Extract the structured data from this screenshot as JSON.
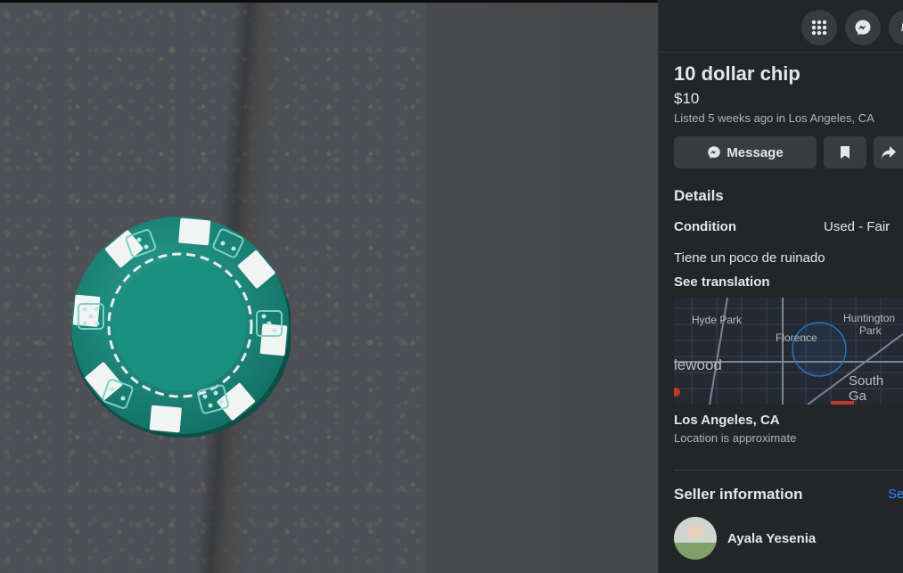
{
  "listing": {
    "title": "10 dollar chip",
    "price": "$10",
    "listed": "Listed 5 weeks ago in Los Angeles, CA"
  },
  "actions": {
    "message_label": "Message",
    "save_icon": "bookmark-icon",
    "share_icon": "share-arrow-icon"
  },
  "topbar": {
    "icons": [
      "apps-grid-icon",
      "messenger-icon",
      "notifications-bell-icon"
    ]
  },
  "details": {
    "heading": "Details",
    "condition_label": "Condition",
    "condition_value": "Used - Fair",
    "description": "Tiene un poco de ruinado",
    "see_translation": "See translation"
  },
  "map": {
    "labels": {
      "hyde_park": "Hyde Park",
      "huntington_line1": "Huntington",
      "huntington_line2": "Park",
      "florence": "Florence",
      "inglewood": "lewood",
      "south_gate": "South Ga"
    }
  },
  "location": {
    "name": "Los Angeles, CA",
    "note": "Location is approximate"
  },
  "seller": {
    "heading": "Seller information",
    "see_link": "Se",
    "name": "Ayala Yesenia"
  },
  "colors": {
    "panel_bg": "#242526",
    "button_bg": "#3a3b3c",
    "text": "#e4e6eb",
    "secondary_text": "#b0b3b8",
    "link": "#2d88ff",
    "chip_green": "#1f8a7d"
  }
}
